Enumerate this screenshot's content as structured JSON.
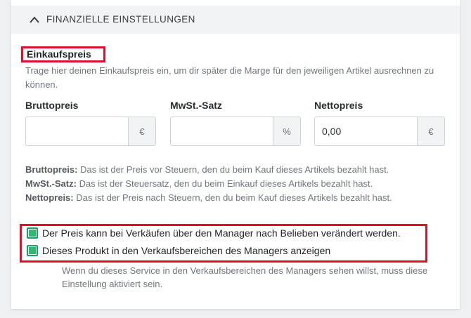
{
  "section": {
    "title": "FINANZIELLE EINSTELLUNGEN"
  },
  "purchase": {
    "title": "Einkaufspreis",
    "description": "Trage hier deinen Einkaufspreis ein, um dir später die Marge für den jeweiligen Artikel ausrechnen zu können."
  },
  "fields": {
    "brutto": {
      "label": "Bruttopreis",
      "value": "",
      "unit": "€"
    },
    "mwst": {
      "label": "MwSt.-Satz",
      "value": "",
      "unit": "%"
    },
    "netto": {
      "label": "Nettopreis",
      "value": "0,00",
      "unit": "€"
    }
  },
  "info": {
    "brutto_term": "Bruttopreis:",
    "brutto_text": " Das ist der Preis vor Steuern, den du beim Kauf dieses Artikels bezahlt hast.",
    "mwst_term": "MwSt.-Satz:",
    "mwst_text": " Das ist der Steuersatz, den du beim Einkauf dieses Artikels bezahlt hast.",
    "netto_term": "Nettopreis:",
    "netto_text": " Das ist der Preis nach Steuern, den du beim Kauf dieses Artikels bezahlt hast."
  },
  "options": {
    "price_changeable": {
      "label": "Der Preis kann bei Verkäufen über den Manager nach Belieben verändert werden.",
      "checked": true
    },
    "show_product": {
      "label": "Dieses Produkt in den Verkaufsbereichen des Managers anzeigen",
      "checked": true
    },
    "hint": "Wenn du dieses Service in den Verkaufsbereichen des Managers sehen willst, muss diese Einstellung aktiviert sein."
  },
  "colors": {
    "highlight": "#e0102b",
    "checkbox": "#2fb874"
  }
}
